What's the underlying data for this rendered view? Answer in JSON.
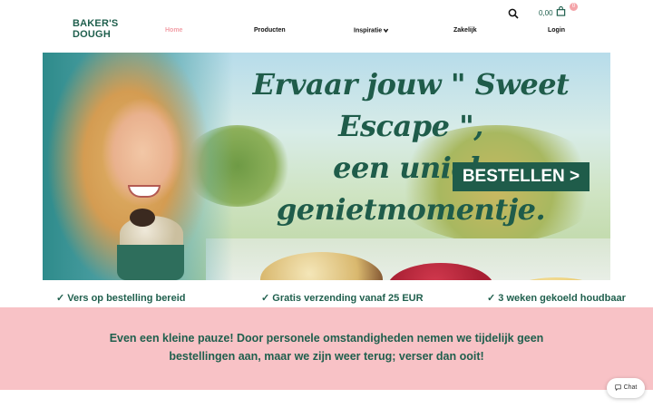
{
  "brand": {
    "logo_line1": "BAKER'S",
    "logo_line2": "DOUGH",
    "color": "#1f5f4d"
  },
  "nav": {
    "items": [
      "Home",
      "Producten",
      "Inspiratie",
      "Zakelijk",
      "Login"
    ],
    "active": "Home",
    "active_color": "#f2a0a8"
  },
  "cart": {
    "total": "0,00",
    "count": "0"
  },
  "hero": {
    "headline_line1": "Ervaar jouw \" Sweet Escape \",",
    "headline_line2": "een uniek genietmomentje.",
    "cta_label": "BESTELLEN >"
  },
  "usps": [
    "✓ Vers op bestelling bereid",
    "✓ Gratis verzending vanaf 25 EUR",
    "✓ 3 weken gekoeld houdbaar"
  ],
  "notice": {
    "line1": "Even een kleine pauze! Door personele omstandigheden nemen we tijdelijk geen",
    "line2": "bestellingen aan, maar we zijn weer terug; verser dan ooit!",
    "background": "#f8c2c6"
  },
  "chat": {
    "label": "Chat"
  }
}
